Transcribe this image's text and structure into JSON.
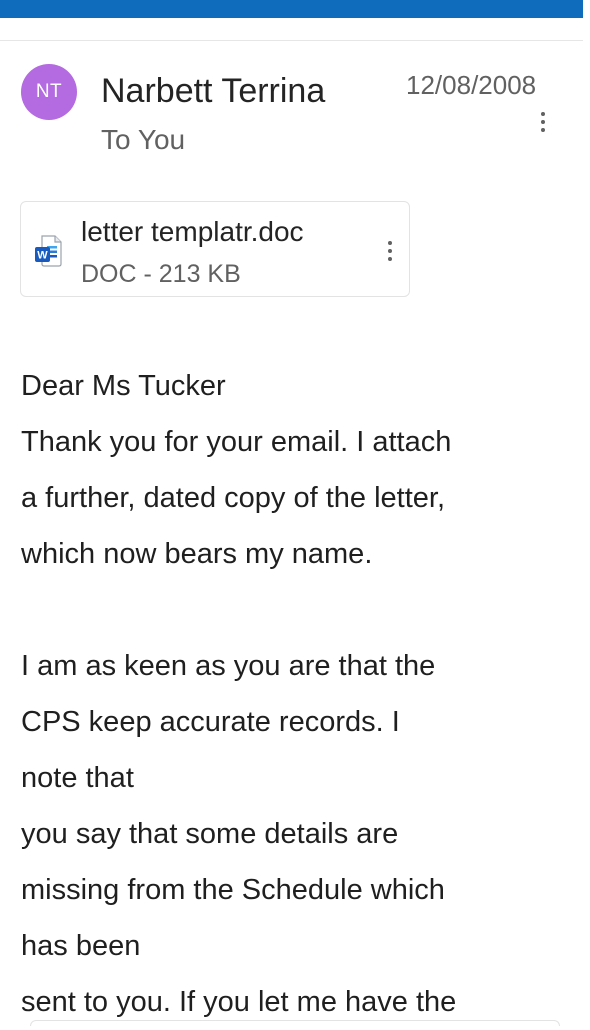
{
  "message": {
    "sender": {
      "initials": "NT",
      "name": "Narbett Terrina",
      "avatar_color": "#b46ae0"
    },
    "recipient": "To You",
    "date": "12/08/2008",
    "more_icon": "more-vertical-icon"
  },
  "attachment": {
    "file_name": "letter templatr.doc",
    "meta": "DOC - 213 KB",
    "icon": "word-doc-icon",
    "more_icon": "more-vertical-icon"
  },
  "body": {
    "lines": [
      "Dear Ms Tucker",
      "Thank you for your email. I attach",
      "a further, dated copy of the letter,",
      "which now bears my name.",
      "",
      "I am as keen as you are that the",
      "CPS keep accurate records. I",
      "note that",
      "you say that some details are",
      "missing from the Schedule which",
      "has been",
      "sent to you. If you let me have the"
    ]
  },
  "colors": {
    "accent": "#0f6cbd",
    "text_primary": "#242424",
    "text_secondary": "#616161"
  }
}
